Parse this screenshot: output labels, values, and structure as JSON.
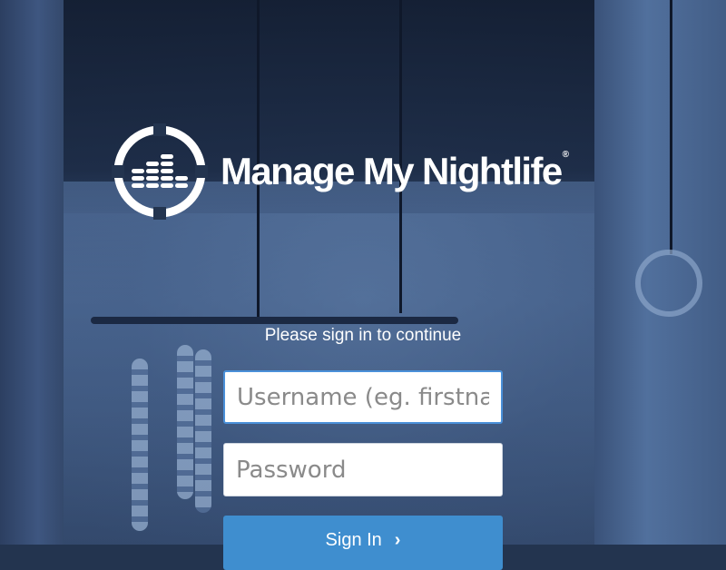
{
  "logo": {
    "name": "Manage My Nightlife",
    "registered_mark": "®"
  },
  "login": {
    "prompt": "Please sign in to continue",
    "username_placeholder": "Username (eg. firstname.lastname)",
    "password_placeholder": "Password",
    "submit_label": "Sign In",
    "submit_icon": "chevron-right-icon"
  },
  "colors": {
    "button_bg": "#3f8ecf",
    "focus_border": "#4a90d9",
    "text": "#ffffff"
  }
}
